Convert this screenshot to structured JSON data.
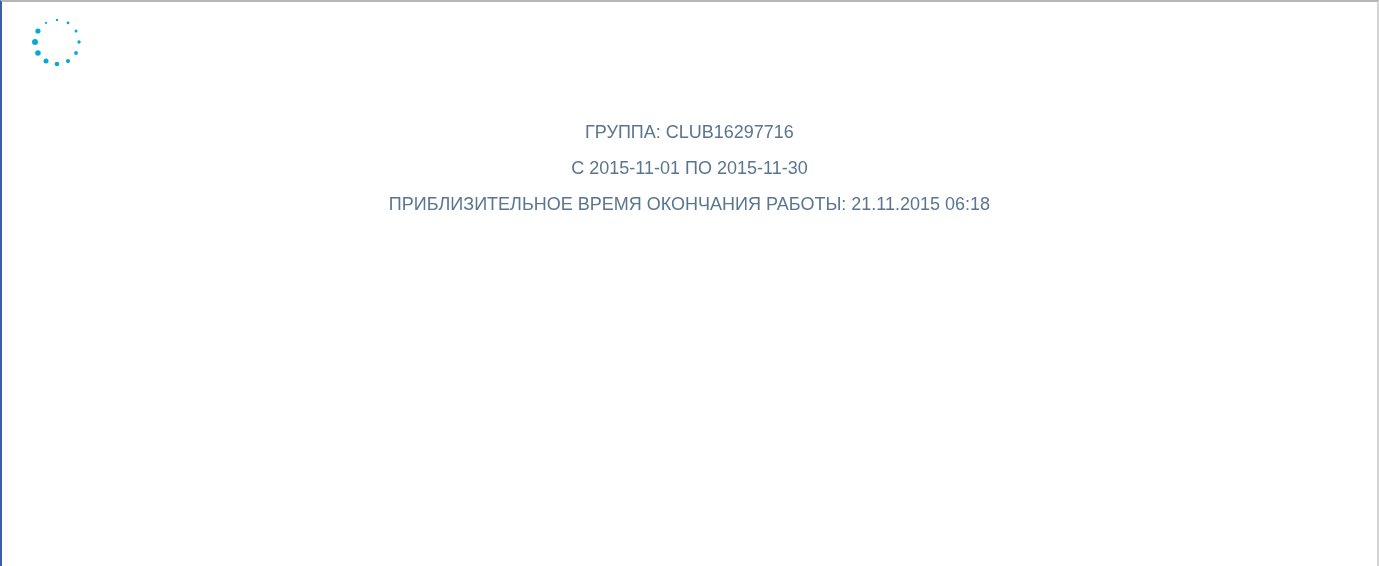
{
  "info_lines": [
    "ГРУППА: CLUB16297716",
    "С 2015-11-01 ПО 2015-11-30",
    "ПРИБЛИЗИТЕЛЬНОЕ ВРЕМЯ ОКОНЧАНИЯ РАБОТЫ: 21.11.2015 06:18"
  ]
}
